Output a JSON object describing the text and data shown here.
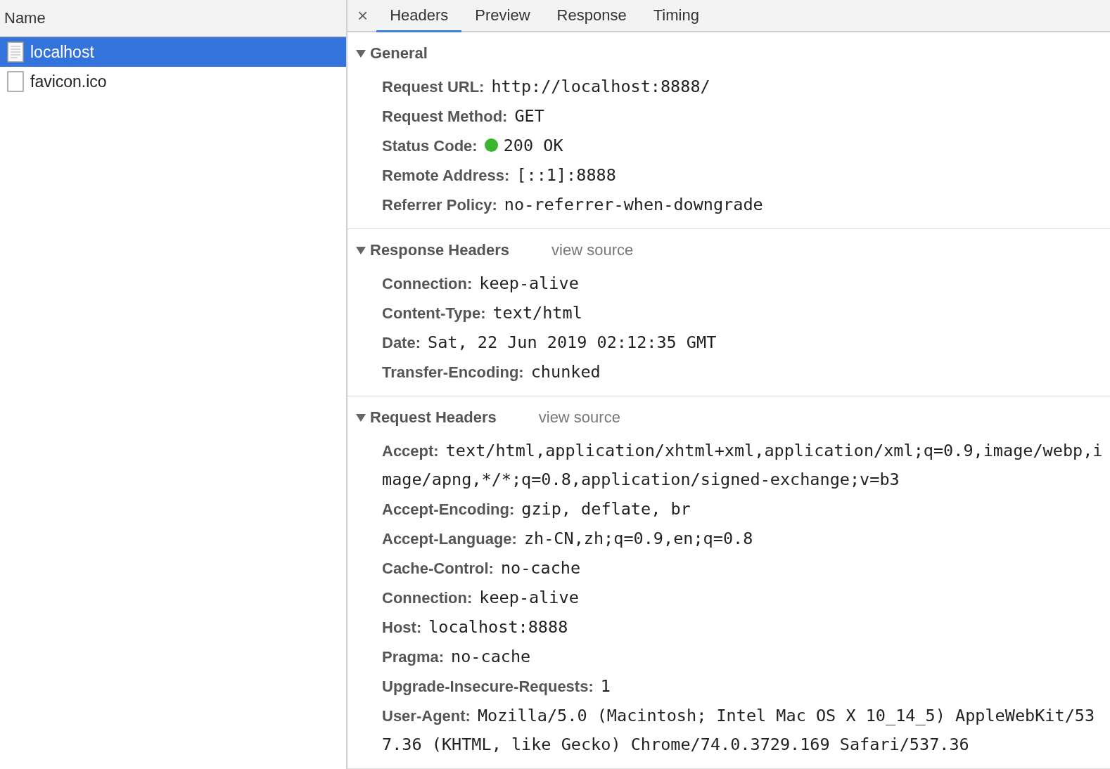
{
  "requests": {
    "column": "Name",
    "items": [
      {
        "name": "localhost",
        "kind": "document",
        "selected": true
      },
      {
        "name": "favicon.ico",
        "kind": "file",
        "selected": false
      }
    ]
  },
  "details": {
    "close": "×",
    "tabs": [
      {
        "label": "Headers",
        "selected": true
      },
      {
        "label": "Preview",
        "selected": false
      },
      {
        "label": "Response",
        "selected": false
      },
      {
        "label": "Timing",
        "selected": false
      }
    ],
    "sections": [
      {
        "title": "General",
        "expanded": true,
        "rows": [
          {
            "name": "Request URL:",
            "value": "http://localhost:8888/"
          },
          {
            "name": "Request Method:",
            "value": "GET"
          },
          {
            "name": "Status Code:",
            "value": "200 OK",
            "color": "#3cb52e"
          },
          {
            "name": "Remote Address:",
            "value": "[::1]:8888"
          },
          {
            "name": "Referrer Policy:",
            "value": "no-referrer-when-downgrade"
          }
        ]
      },
      {
        "title": "Response Headers",
        "link": "view source",
        "expanded": true,
        "rows": [
          {
            "name": "Connection:",
            "value": "keep-alive"
          },
          {
            "name": "Content-Type:",
            "value": "text/html"
          },
          {
            "name": "Date:",
            "value": "Sat, 22 Jun 2019 02:12:35 GMT"
          },
          {
            "name": "Transfer-Encoding:",
            "value": "chunked"
          }
        ]
      },
      {
        "title": "Request Headers",
        "link": "view source",
        "expanded": true,
        "rows": [
          {
            "name": "Accept:",
            "value": "text/html,application/xhtml+xml,application/xml;q=0.9,image/webp,image/apng,*/*;q=0.8,application/signed-exchange;v=b3"
          },
          {
            "name": "Accept-Encoding:",
            "value": "gzip, deflate, br"
          },
          {
            "name": "Accept-Language:",
            "value": "zh-CN,zh;q=0.9,en;q=0.8"
          },
          {
            "name": "Cache-Control:",
            "value": "no-cache"
          },
          {
            "name": "Connection:",
            "value": "keep-alive"
          },
          {
            "name": "Host:",
            "value": "localhost:8888"
          },
          {
            "name": "Pragma:",
            "value": "no-cache"
          },
          {
            "name": "Upgrade-Insecure-Requests:",
            "value": "1"
          },
          {
            "name": "User-Agent:",
            "value": "Mozilla/5.0 (Macintosh; Intel Mac OS X 10_14_5) AppleWebKit/537.36 (KHTML, like Gecko) Chrome/74.0.3729.169 Safari/537.36"
          }
        ]
      }
    ]
  }
}
